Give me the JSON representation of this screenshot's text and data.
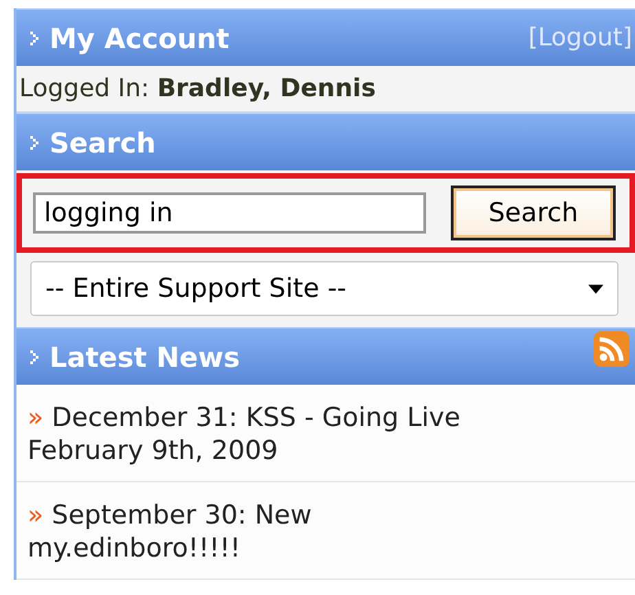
{
  "account": {
    "title": "My Account",
    "logout": "[Logout]",
    "logged_in_label": "Logged In: ",
    "user": "Bradley, Dennis"
  },
  "search": {
    "title": "Search",
    "value": "logging in",
    "button": "Search",
    "highlighted": true,
    "scope": "-- Entire Support Site --"
  },
  "news": {
    "title": "Latest News",
    "items": [
      {
        "marker": "»",
        "lines": [
          "December 31: KSS - Going Live",
          "February 9th, 2009"
        ]
      },
      {
        "marker": "»",
        "lines": [
          "September 30: New",
          "my.edinboro!!!!!"
        ]
      }
    ]
  }
}
